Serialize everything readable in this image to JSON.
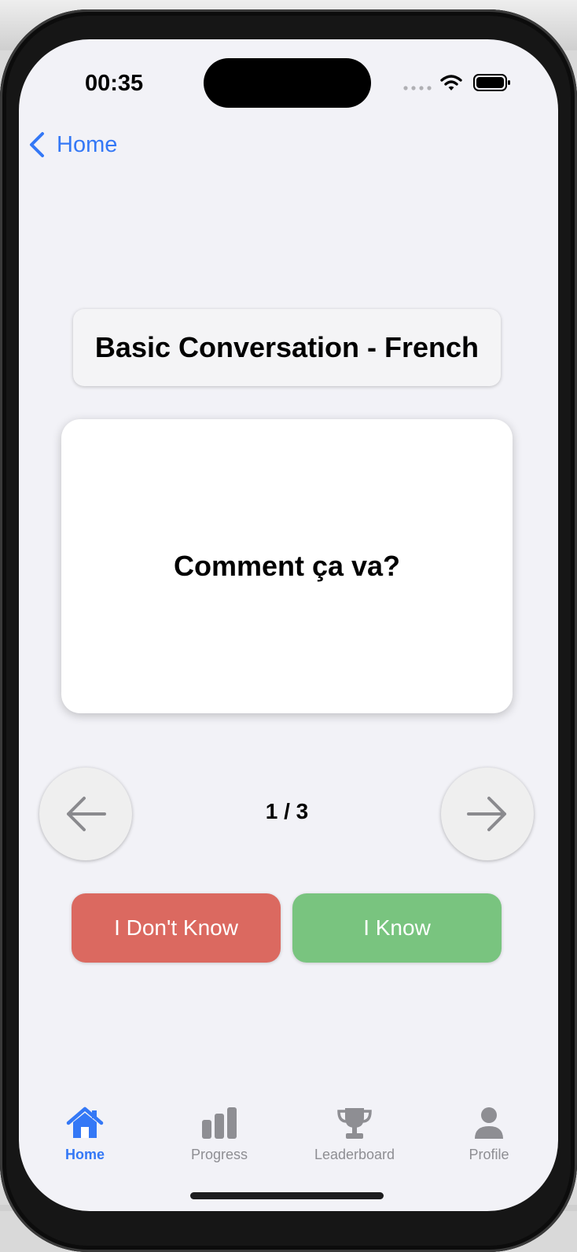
{
  "status_bar": {
    "time": "00:35"
  },
  "nav": {
    "back_label": "Home"
  },
  "deck": {
    "title": "Basic Conversation - French"
  },
  "card": {
    "text": "Comment ça va?"
  },
  "pager": {
    "current": 1,
    "total": 3,
    "text": "1 / 3"
  },
  "actions": {
    "dont_know_label": "I Don't Know",
    "know_label": "I Know"
  },
  "tab_bar": {
    "tabs": [
      {
        "label": "Home",
        "icon": "house-icon",
        "active": true
      },
      {
        "label": "Progress",
        "icon": "bar-chart-icon",
        "active": false
      },
      {
        "label": "Leaderboard",
        "icon": "trophy-icon",
        "active": false
      },
      {
        "label": "Profile",
        "icon": "person-icon",
        "active": false
      }
    ]
  },
  "colors": {
    "accent": "#3478f6",
    "dont_know": "#db6960",
    "know": "#79c47f",
    "background": "#f2f2f7",
    "inactive_tab": "#8e8e93"
  }
}
